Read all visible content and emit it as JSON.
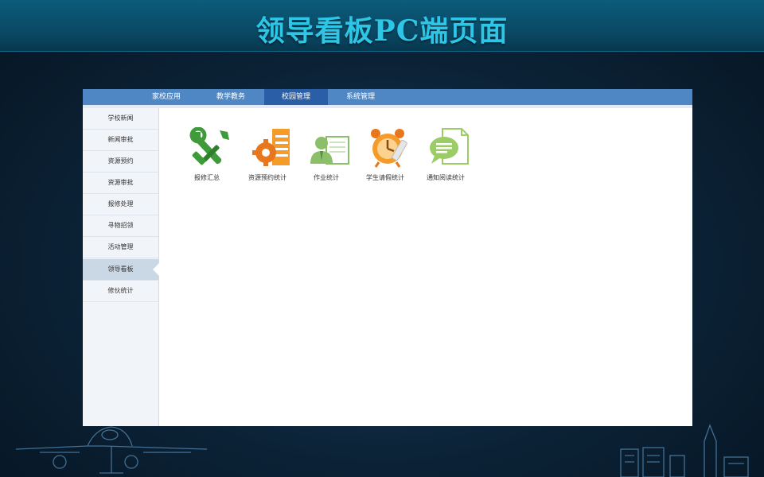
{
  "banner": {
    "title": "领导看板PC端页面"
  },
  "topnav": {
    "tabs": [
      {
        "label": "家校应用",
        "active": false
      },
      {
        "label": "教学教务",
        "active": false
      },
      {
        "label": "校园管理",
        "active": true
      },
      {
        "label": "系统管理",
        "active": false
      }
    ]
  },
  "sidebar": {
    "items": [
      {
        "label": "学校新闻",
        "active": false
      },
      {
        "label": "新闻审批",
        "active": false
      },
      {
        "label": "资源预约",
        "active": false
      },
      {
        "label": "资源审批",
        "active": false
      },
      {
        "label": "报修处理",
        "active": false
      },
      {
        "label": "寻物招领",
        "active": false
      },
      {
        "label": "活动管理",
        "active": false
      },
      {
        "label": "领导看板",
        "active": true
      },
      {
        "label": "修伙统计",
        "active": false
      }
    ]
  },
  "dashboard": {
    "tiles": [
      {
        "label": "报修汇总",
        "icon": "wrench-screwdriver-icon",
        "color": "#3f9a3a"
      },
      {
        "label": "资源预约统计",
        "icon": "gear-document-icon",
        "color": "#e8761c"
      },
      {
        "label": "作业统计",
        "icon": "person-board-icon",
        "color": "#8bbf6a"
      },
      {
        "label": "学生请假统计",
        "icon": "alarm-clock-icon",
        "color": "#e8761c"
      },
      {
        "label": "通知阅读统计",
        "icon": "chat-document-icon",
        "color": "#9ccc65"
      }
    ]
  }
}
